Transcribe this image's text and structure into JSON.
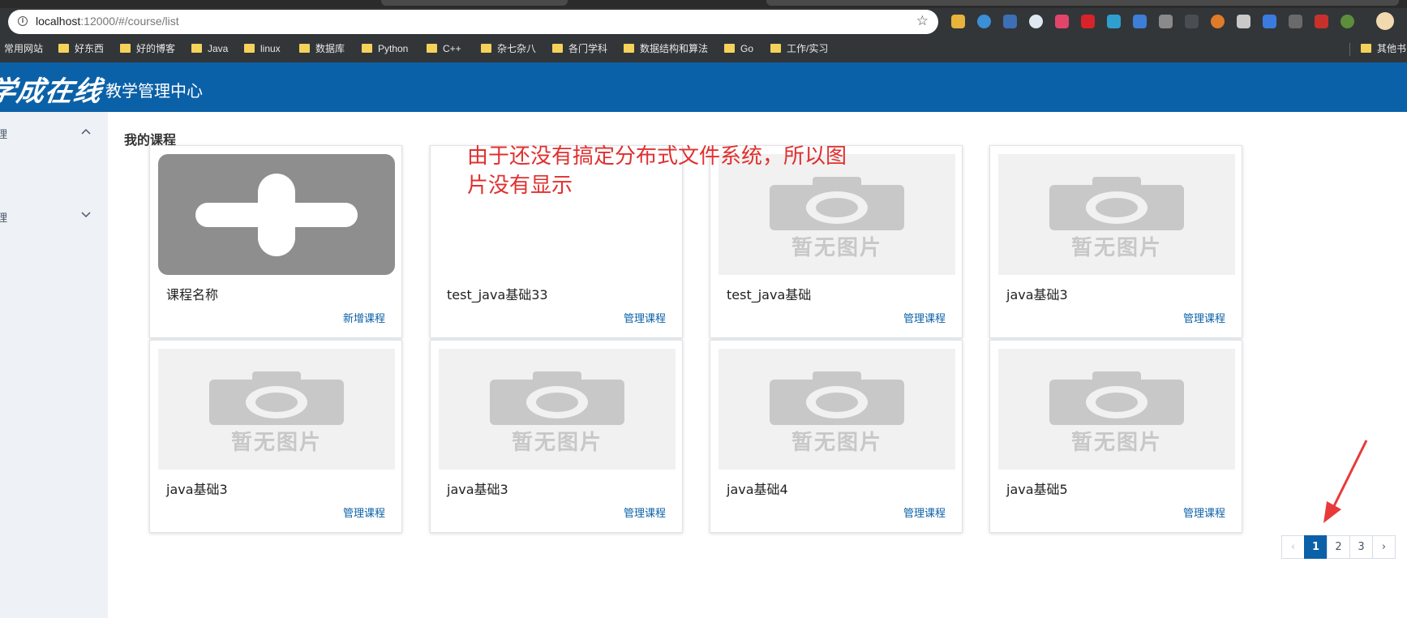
{
  "browser": {
    "url_host": "localhost",
    "url_rest": ":12000/#/course/list",
    "bookmark_folders": [
      "常用网站",
      "好东西",
      "好的博客",
      "Java",
      "linux",
      "数据库",
      "Python",
      "C++",
      "杂七杂八",
      "各门学科",
      "数据结构和算法",
      "Go",
      "工作/实习"
    ],
    "other_bookmarks": "其他书"
  },
  "header": {
    "logo": "学成在线",
    "title": "教学管理中心"
  },
  "sidebar": {
    "items": [
      {
        "label": "理",
        "expanded": true
      },
      {
        "label": "理",
        "expanded": false
      }
    ]
  },
  "main": {
    "page_title": "我的课程",
    "annotation": "由于还没有搞定分布式文件系统，所以图片没有显示",
    "placeholder_text": "暂无图片",
    "cards": [
      {
        "name": "课程名称",
        "action": "新增课程",
        "image": "add-placeholder"
      },
      {
        "name": "test_java基础33",
        "action": "管理课程",
        "image": "blank"
      },
      {
        "name": "test_java基础",
        "action": "管理课程",
        "image": "no-image"
      },
      {
        "name": "java基础3",
        "action": "管理课程",
        "image": "no-image"
      },
      {
        "name": "java基础3",
        "action": "管理课程",
        "image": "no-image"
      },
      {
        "name": "java基础3",
        "action": "管理课程",
        "image": "no-image"
      },
      {
        "name": "java基础4",
        "action": "管理课程",
        "image": "no-image"
      },
      {
        "name": "java基础5",
        "action": "管理课程",
        "image": "no-image"
      }
    ]
  },
  "pagination": {
    "prev": "‹",
    "pages": [
      "1",
      "2",
      "3"
    ],
    "current": "1",
    "next": "›"
  },
  "colors": {
    "brand": "#0b61a8",
    "annotation": "#e03030",
    "annotation_arrow": "#e83a3a"
  }
}
